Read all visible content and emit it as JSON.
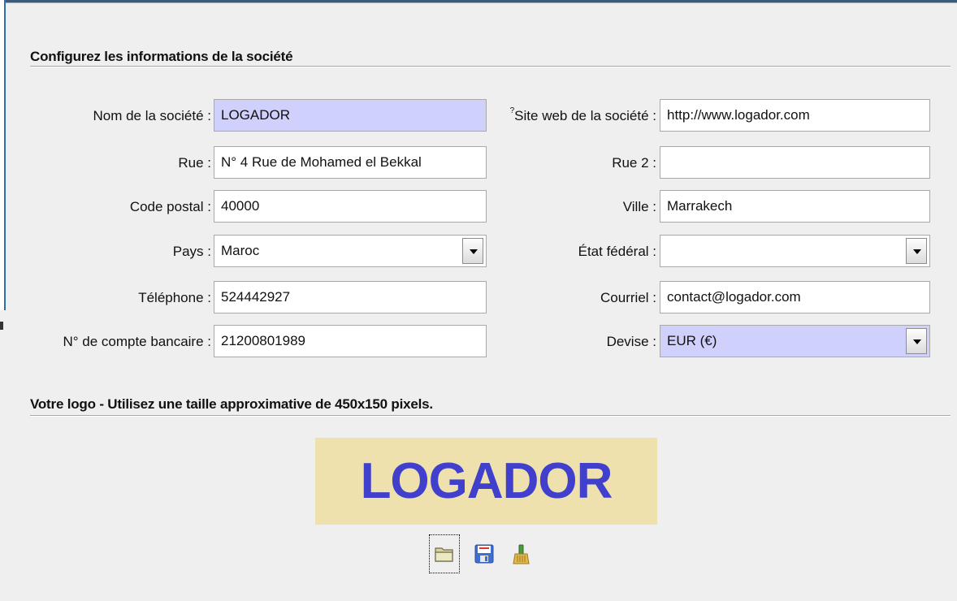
{
  "header": {
    "title": "Configurez les informations de la société"
  },
  "fields": {
    "company_name": {
      "label": "Nom de la société :",
      "value": "LOGADOR"
    },
    "website": {
      "marker": "?",
      "label": "Site web de la société :",
      "value": "http://www.logador.com"
    },
    "street": {
      "label": "Rue :",
      "value": "N° 4 Rue de Mohamed el Bekkal"
    },
    "street2": {
      "label": "Rue 2 :",
      "value": ""
    },
    "postal_code": {
      "label": "Code postal :",
      "value": "40000"
    },
    "city": {
      "label": "Ville :",
      "value": "Marrakech"
    },
    "country": {
      "label": "Pays :",
      "value": "Maroc"
    },
    "state": {
      "label": "État fédéral :",
      "value": ""
    },
    "phone": {
      "label": "Téléphone :",
      "value": "524442927"
    },
    "email": {
      "label": "Courriel :",
      "value": "contact@logador.com"
    },
    "bank_account": {
      "label": "N° de compte bancaire :",
      "value": "21200801989"
    },
    "currency": {
      "label": "Devise :",
      "value": "EUR (€)"
    }
  },
  "logo_section": {
    "title": "Votre logo - Utilisez une taille approximative de 450x150 pixels.",
    "logo_text": "LOGADOR",
    "icons": [
      "folder-open-icon",
      "save-disk-icon",
      "clear-broom-icon"
    ]
  },
  "colors": {
    "highlight_field": "#d0d0fc",
    "logo_background": "#efe1ad",
    "logo_text": "#4040cc",
    "background": "#efefef"
  }
}
